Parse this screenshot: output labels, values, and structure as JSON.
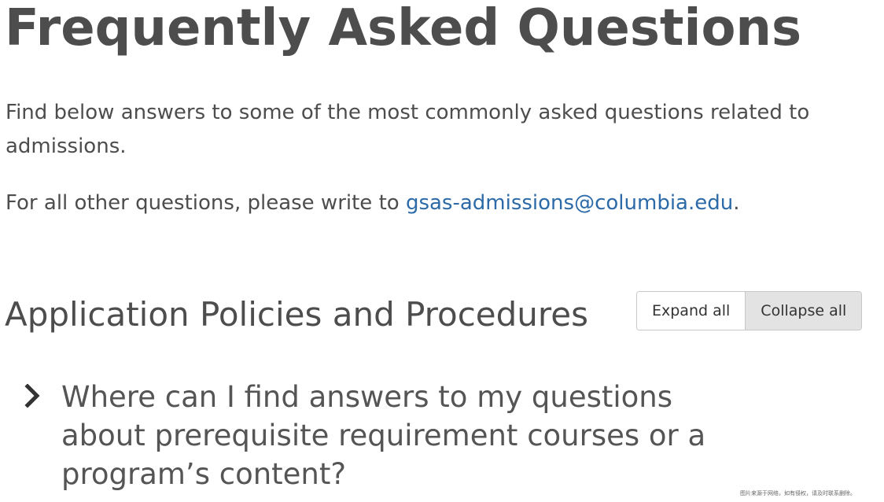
{
  "page": {
    "title": "Frequently Asked Questions",
    "intro": "Find below answers to some of the most commonly asked questions related to admissions.",
    "contact_prefix": "For all other questions, please write to ",
    "contact_email": "gsas-admissions@columbia.edu",
    "contact_suffix": "."
  },
  "section": {
    "heading": "Application Policies and Procedures",
    "expand_label": "Expand all",
    "collapse_label": "Collapse all",
    "active_button": "collapse"
  },
  "faq": {
    "items": [
      {
        "question": "Where can I find answers to my questions about prerequisite requirement courses or a program’s content?",
        "expanded": false
      }
    ]
  },
  "watermark": "图片来源于网络，如有侵权，请及时联系删除。",
  "colors": {
    "text": "#4d4d4d",
    "link": "#2c6aa8",
    "button_active_bg": "#e3e3e3",
    "button_border": "#c8c8c8"
  },
  "icons": {
    "faq_toggle": "chevron-right-icon"
  }
}
